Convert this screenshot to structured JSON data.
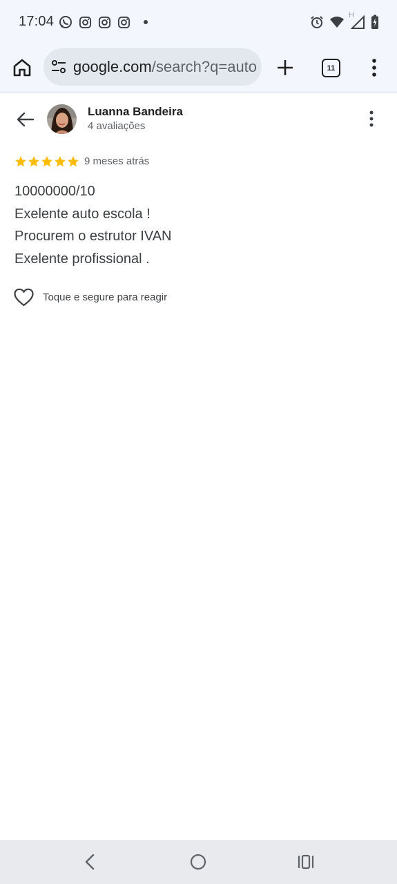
{
  "status_bar": {
    "time": "17:04",
    "left_icons": [
      "whatsapp-icon",
      "instagram-icon",
      "instagram-icon",
      "instagram-icon",
      "dot-icon"
    ],
    "right_icons": [
      "alarm-icon",
      "wifi-icon",
      "signal-icon",
      "battery-charging-icon"
    ],
    "network_label": "H"
  },
  "browser": {
    "url_host": "google.com",
    "url_path": "/search?q=auto",
    "tab_count": "11"
  },
  "review": {
    "reviewer_name": "Luanna Bandeira",
    "reviewer_reviews": "4 avaliações",
    "rating": 5,
    "rating_max": 5,
    "date": "9 meses atrás",
    "lines": [
      "10000000/10",
      "Exelente auto escola !",
      "Procurem o estrutor IVAN",
      "Exelente profissional ."
    ],
    "react_label": "Toque e segure para reagir"
  },
  "colors": {
    "star": "#fbbc04",
    "toolbar_bg": "#f3f6fc",
    "omnibox_bg": "#e3e8ef",
    "nav_bg": "#e8eaed"
  }
}
